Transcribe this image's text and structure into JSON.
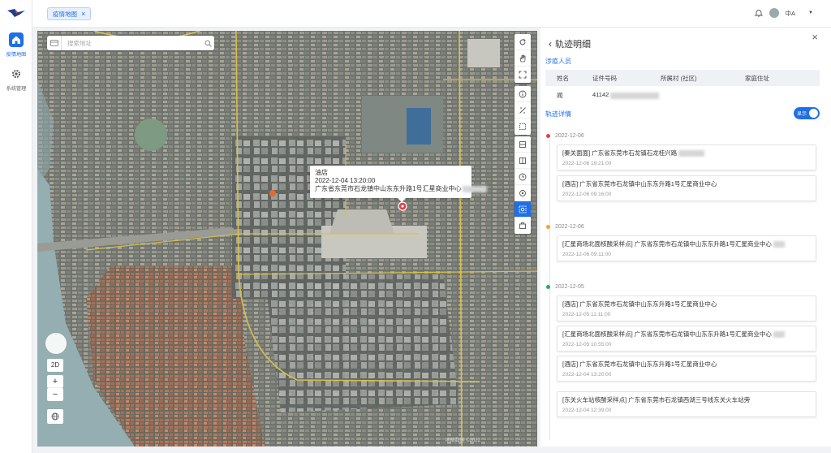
{
  "nav": {
    "items": [
      {
        "label": "疫情地图",
        "icon": "home-icon",
        "active": true
      },
      {
        "label": "系统管理",
        "icon": "gear-icon",
        "active": false
      }
    ]
  },
  "tabs": [
    {
      "label": "疫情地图"
    }
  ],
  "user": {
    "name": "中A"
  },
  "map": {
    "search_placeholder": "搜索地址",
    "popup": {
      "name": "油店",
      "time": "2022-12-04 13:20:00",
      "address": "广东省东莞市石龙镇中山东东升路1号汇星商业中心"
    },
    "mode_label": "2D",
    "zoom_in": "+",
    "zoom_out": "−",
    "attribution": "地图数据 ©2022"
  },
  "panel": {
    "title": "轨迹明细",
    "person_section": "涉疫人员",
    "table_headers": [
      "姓名",
      "证件号码",
      "所属村 (社区)",
      "家庭住址"
    ],
    "person": {
      "name": "闻",
      "id": "41142"
    },
    "track_section": "轨迹详情",
    "toggle_label": "显示",
    "days": [
      {
        "date": "2022-12-06",
        "color": "#e0424a",
        "entries": [
          {
            "place": "[秦关面面] 广东省东莞市石龙镇石龙桂兴路",
            "time": "2022-12-06 19:21:00"
          },
          {
            "place": "[酒店] 广东省东莞市石龙镇中山东东升路1号汇星商业中心",
            "time": "2022-12-06 09:16:00"
          }
        ]
      },
      {
        "date": "2022-12-06",
        "color": "#f5a623",
        "entries": [
          {
            "place": "[汇星商场北面核酸采样点] 广东省东莞市石龙镇中山东东升路1号汇星商业中心",
            "time": "2022-12-06 09:11:00"
          }
        ]
      },
      {
        "date": "2022-12-05",
        "color": "#27ae60",
        "entries": [
          {
            "place": "[酒店] 广东省东莞市石龙镇中山东东升路1号汇星商业中心",
            "time": "2022-12-05 11:11:00"
          },
          {
            "place": "[汇星商场北面核酸采样点] 广东省东莞市石龙镇中山东东升路1号汇星商业中心",
            "time": "2022-12-05 10:55:00"
          },
          {
            "place": "[酒店] 广东省东莞市石龙镇中山东东升路1号汇星商业中心",
            "time": "2022-12-04 13:20:00"
          },
          {
            "place": "[东关火车站核酸采样点] 广东省东莞市石龙镇西湖三号线东关火车站旁",
            "time": "2022-12-04 12:39:00"
          }
        ]
      }
    ]
  }
}
